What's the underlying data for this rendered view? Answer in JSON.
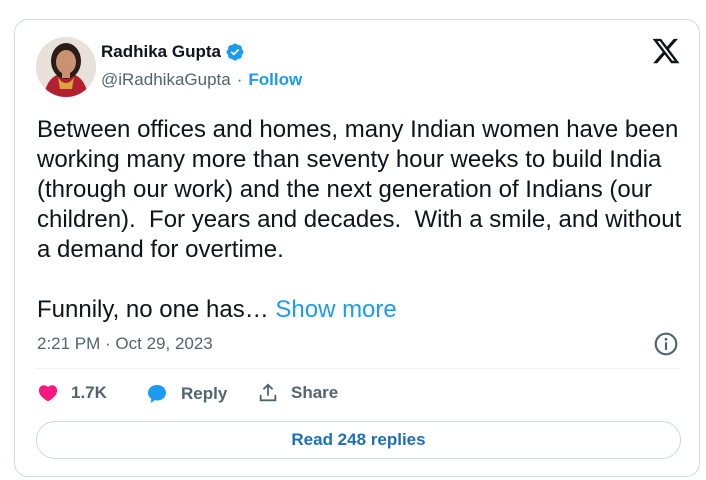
{
  "author": {
    "display_name": "Radhika Gupta",
    "handle": "@iRadhikaGupta",
    "separator": "·",
    "follow_label": "Follow",
    "verified": true
  },
  "tweet": {
    "text": "Between offices and homes, many Indian women have been working many more than seventy hour weeks to build India (through our work) and the next generation of Indians (our children).  For years and decades.  With a smile, and without a demand for overtime.\n\nFunnily, no one has… ",
    "show_more_label": "Show more",
    "timestamp": "2:21 PM · Oct 29, 2023"
  },
  "actions": {
    "like_count": "1.7K",
    "reply_label": "Reply",
    "share_label": "Share"
  },
  "read_replies_label": "Read 248 replies",
  "colors": {
    "accent": "#1d9bf0",
    "like": "#f91880",
    "text": "#0f1419",
    "muted": "#536471"
  },
  "icons": [
    "verified-badge-icon",
    "x-logo-icon",
    "info-icon",
    "heart-icon",
    "reply-bubble-icon",
    "share-upload-icon"
  ]
}
